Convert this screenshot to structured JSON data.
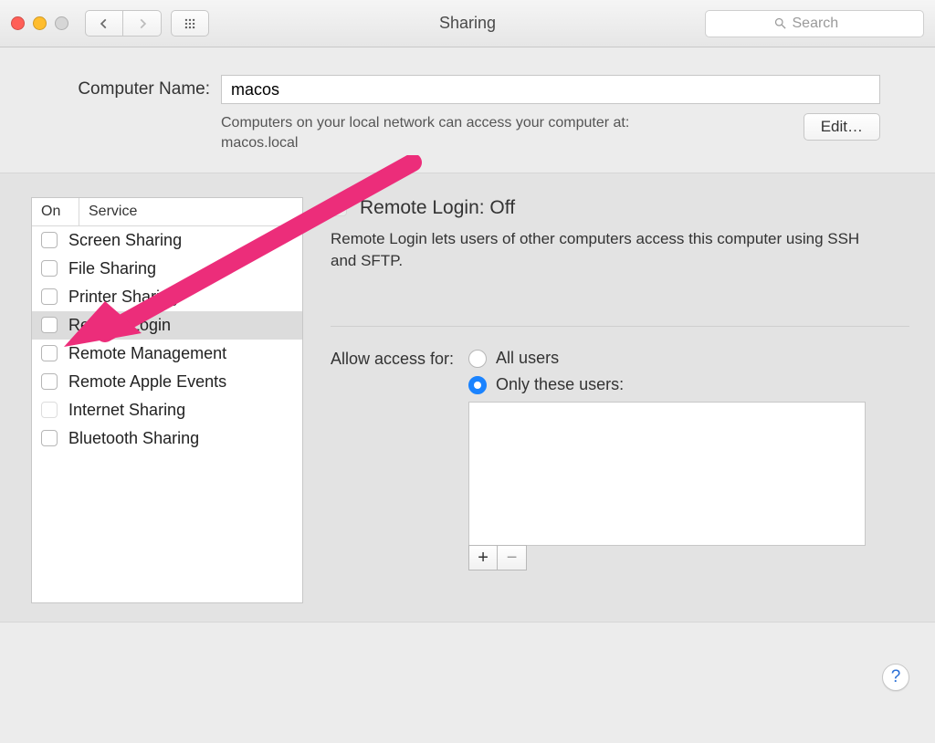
{
  "window": {
    "title": "Sharing"
  },
  "search": {
    "placeholder": "Search"
  },
  "computerName": {
    "label": "Computer Name:",
    "value": "macos",
    "helpLine1": "Computers on your local network can access your computer at:",
    "helpLine2": "macos.local",
    "editLabel": "Edit…"
  },
  "serviceList": {
    "headerOn": "On",
    "headerService": "Service",
    "items": [
      {
        "label": "Screen Sharing",
        "dim": false
      },
      {
        "label": "File Sharing",
        "dim": false
      },
      {
        "label": "Printer Sharing",
        "dim": false
      },
      {
        "label": "Remote Login",
        "dim": false,
        "selected": true
      },
      {
        "label": "Remote Management",
        "dim": false
      },
      {
        "label": "Remote Apple Events",
        "dim": false
      },
      {
        "label": "Internet Sharing",
        "dim": true
      },
      {
        "label": "Bluetooth Sharing",
        "dim": false
      }
    ]
  },
  "detail": {
    "statusTitle": "Remote Login: Off",
    "description": "Remote Login lets users of other computers access this computer using SSH and SFTP.",
    "accessLabel": "Allow access for:",
    "radioAll": "All users",
    "radioOnly": "Only these users:",
    "addSymbol": "+",
    "removeSymbol": "−"
  },
  "help": {
    "symbol": "?"
  },
  "annotation": {
    "color": "#ec2d7a"
  }
}
